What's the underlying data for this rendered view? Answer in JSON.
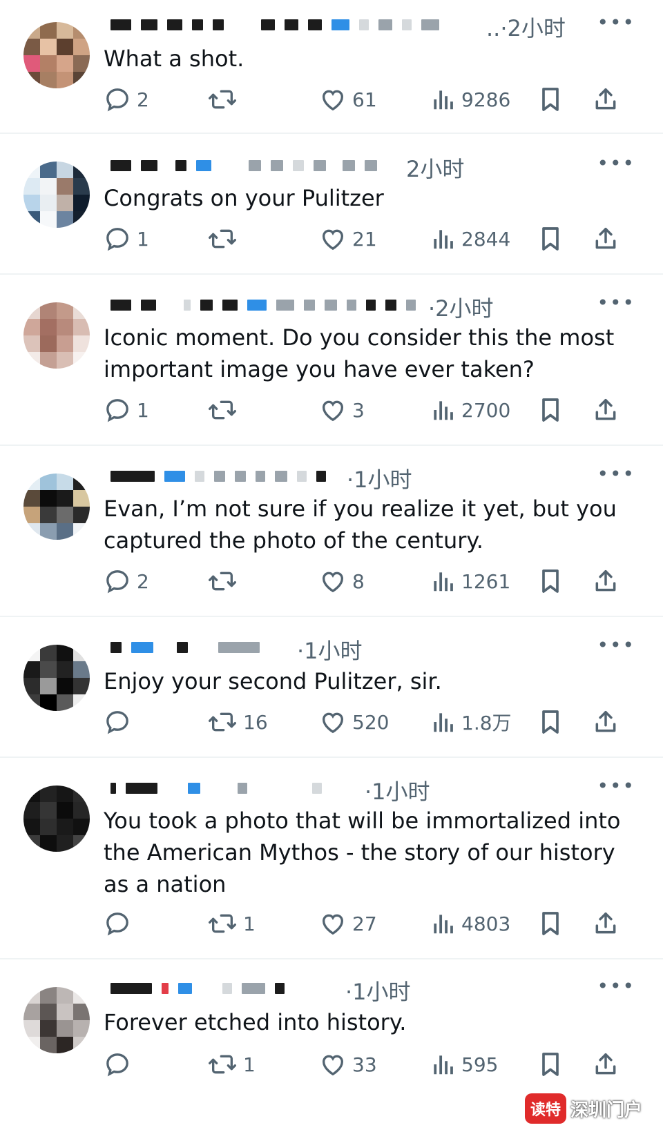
{
  "tweets": [
    {
      "time": "..·2小时",
      "text": "What a shot.",
      "replies": "2",
      "retweets": "",
      "likes": "61",
      "views": "9286"
    },
    {
      "time": "2小时",
      "text": "Congrats on your Pulitzer",
      "replies": "1",
      "retweets": "",
      "likes": "21",
      "views": "2844"
    },
    {
      "time": "·2小时",
      "text": "Iconic moment. Do you consider this the most important image you have ever taken?",
      "replies": "1",
      "retweets": "",
      "likes": "3",
      "views": "2700"
    },
    {
      "time": "·1小时",
      "text": "Evan, I’m not sure if you realize it yet, but you captured the photo of the century.",
      "replies": "2",
      "retweets": "",
      "likes": "8",
      "views": "1261"
    },
    {
      "time": "·1小时",
      "text": "Enjoy your second Pulitzer, sir.",
      "replies": "",
      "retweets": "16",
      "likes": "520",
      "views": "1.8万"
    },
    {
      "time": "·1小时",
      "text": "You took a photo that will be immortalized into the American Mythos - the story of our history as a nation",
      "replies": "",
      "retweets": "1",
      "likes": "27",
      "views": "4803"
    },
    {
      "time": "·1小时",
      "text": "Forever etched into history.",
      "replies": "",
      "retweets": "1",
      "likes": "33",
      "views": "595"
    }
  ],
  "more_label": "•••",
  "watermark": {
    "badge": "读特",
    "text": "深圳门户"
  },
  "colors": {
    "muted": "#536471",
    "text": "#0f1419",
    "divider": "#eff3f4"
  }
}
